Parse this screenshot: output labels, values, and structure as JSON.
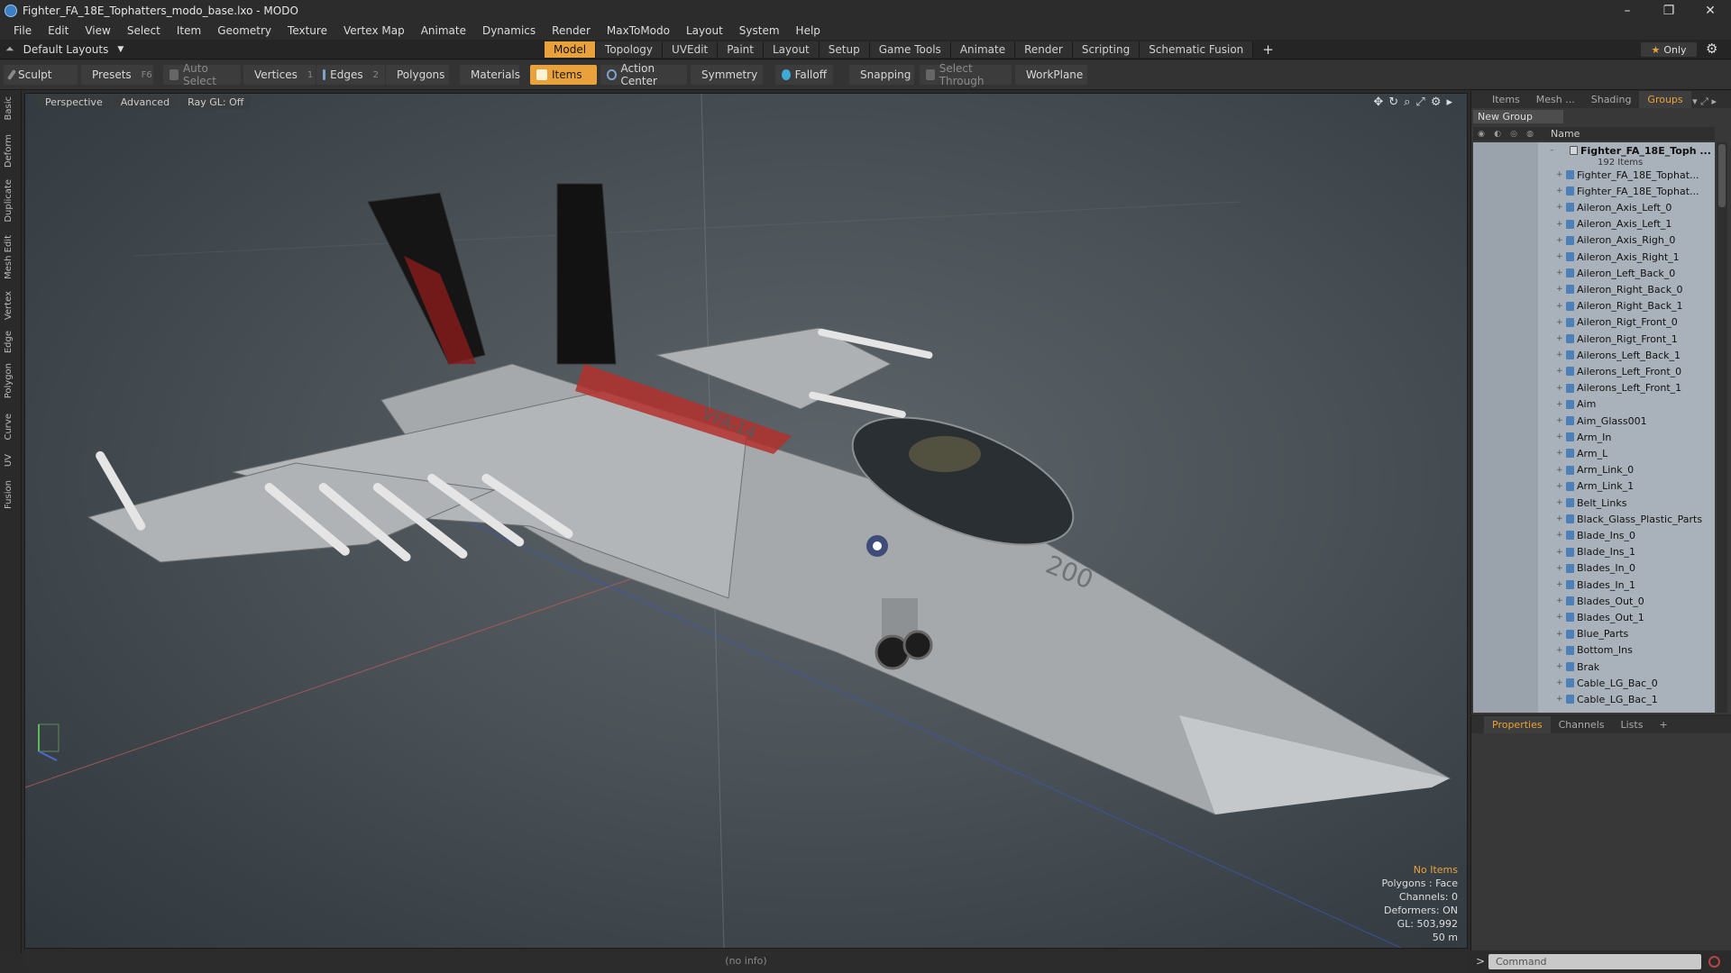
{
  "window": {
    "title": "Fighter_FA_18E_Tophatters_modo_base.lxo - MODO"
  },
  "menu": [
    "File",
    "Edit",
    "View",
    "Select",
    "Item",
    "Geometry",
    "Texture",
    "Vertex Map",
    "Animate",
    "Dynamics",
    "Render",
    "MaxToModo",
    "Layout",
    "System",
    "Help"
  ],
  "layout": {
    "name": "Default Layouts"
  },
  "tabs": [
    "Model",
    "Topology",
    "UVEdit",
    "Paint",
    "Layout",
    "Setup",
    "Game Tools",
    "Animate",
    "Render",
    "Scripting",
    "Schematic Fusion"
  ],
  "active_tab": "Model",
  "only_label": "Only",
  "toolbar": {
    "sculpt": "Sculpt",
    "presets": "Presets",
    "presets_key": "F6",
    "auto_select": "Auto Select",
    "vertices": "Vertices",
    "vertices_key": "1",
    "edges": "Edges",
    "edges_key": "2",
    "polygons": "Polygons",
    "materials": "Materials",
    "items": "Items",
    "action_center": "Action Center",
    "symmetry": "Symmetry",
    "falloff": "Falloff",
    "snapping": "Snapping",
    "select_through": "Select Through",
    "workplane": "WorkPlane"
  },
  "left_tabs": [
    "Basic",
    "Deform",
    "Duplicate",
    "Mesh Edit",
    "Vertex",
    "Edge",
    "Polygon",
    "Curve",
    "UV",
    "Fusion"
  ],
  "viewport": {
    "view_mode": "Perspective",
    "advanced": "Advanced",
    "raygl": "Ray GL: Off",
    "info": {
      "selection": "No Items",
      "polygons": "Polygons : Face",
      "channels": "Channels: 0",
      "deformers": "Deformers: ON",
      "gl": "GL: 503,992",
      "scale": "50 m"
    }
  },
  "status": "(no info)",
  "right_panel": {
    "tabs": [
      "Items",
      "Mesh ...",
      "Shading",
      "Groups"
    ],
    "active_tab": "Groups",
    "new_group": "New Group",
    "column_name": "Name",
    "root": {
      "name": "Fighter_FA_18E_Toph ...",
      "count": "192 Items"
    },
    "children": [
      "Fighter_FA_18E_Tophat...",
      "Fighter_FA_18E_Tophat...",
      "Aileron_Axis_Left_0",
      "Aileron_Axis_Left_1",
      "Aileron_Axis_Righ_0",
      "Aileron_Axis_Right_1",
      "Aileron_Left_Back_0",
      "Aileron_Right_Back_0",
      "Aileron_Right_Back_1",
      "Aileron_Rigt_Front_0",
      "Aileron_Rigt_Front_1",
      "Ailerons_Left_Back_1",
      "Ailerons_Left_Front_0",
      "Ailerons_Left_Front_1",
      "Aim",
      "Aim_Glass001",
      "Arm_In",
      "Arm_L",
      "Arm_Link_0",
      "Arm_Link_1",
      "Belt_Links",
      "Black_Glass_Plastic_Parts",
      "Blade_Ins_0",
      "Blade_Ins_1",
      "Blades_In_0",
      "Blades_In_1",
      "Blades_Out_0",
      "Blades_Out_1",
      "Blue_Parts",
      "Bottom_Ins",
      "Brak",
      "Cable_LG_Bac_0",
      "Cable_LG_Bac_1"
    ]
  },
  "props_panel": {
    "tabs": [
      "Properties",
      "Channels",
      "Lists"
    ],
    "active_tab": "Properties"
  },
  "command": {
    "placeholder": "Command"
  },
  "colors": {
    "accent": "#e9a23b",
    "panel": "#383838",
    "tree_bg": "#a9b2ba"
  }
}
